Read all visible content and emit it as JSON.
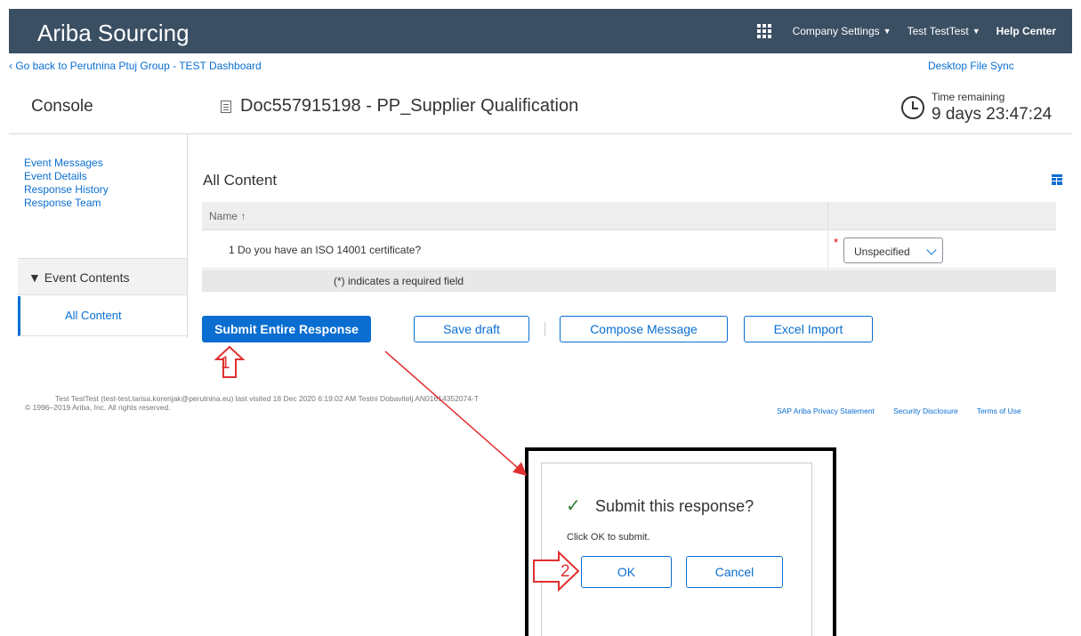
{
  "header": {
    "app_title": "Ariba Sourcing",
    "company_settings": "Company Settings",
    "user_menu": "Test TestTest",
    "help_center": "Help Center"
  },
  "nav": {
    "back_link": "Go back to Perutnina Ptuj Group - TEST Dashboard",
    "desktop_sync": "Desktop File Sync"
  },
  "page": {
    "console_label": "Console",
    "doc_title": "Doc557915198 - PP_Supplier Qualification",
    "time_remaining_label": "Time remaining",
    "time_remaining_value": "9 days 23:47:24"
  },
  "sidebar": {
    "links": [
      "Event Messages",
      "Event Details",
      "Response History",
      "Response Team"
    ],
    "event_contents": "Event Contents",
    "all_content": "All Content"
  },
  "content": {
    "section_title": "All Content",
    "column_name": "Name",
    "rows": [
      {
        "label": "1  Do you have an ISO 14001 certificate?",
        "required": "*",
        "value": "Unspecified"
      }
    ],
    "required_note": "(*) indicates a required field"
  },
  "actions": {
    "submit": "Submit Entire Response",
    "save_draft": "Save draft",
    "compose": "Compose Message",
    "excel_import": "Excel Import"
  },
  "footer": {
    "user_line": "Test TestTest (test-test.larisa.korenjak@perutnina.eu) last visited 18 Dec 2020 6:19:02 AM   Testni Dobavitelj  AN01614352074-T",
    "copyright": "© 1996–2019 Ariba, Inc. All rights reserved.",
    "links": [
      "SAP Ariba Privacy Statement",
      "Security Disclosure",
      "Terms of Use"
    ]
  },
  "dialog": {
    "title": "Submit this response?",
    "message": "Click OK to submit.",
    "ok": "OK",
    "cancel": "Cancel"
  },
  "annotations": {
    "step1": "1",
    "step2": "2",
    "color": "#e03030"
  },
  "colors": {
    "header_bg": "#3b4f63",
    "accent": "#0a6ed1"
  }
}
